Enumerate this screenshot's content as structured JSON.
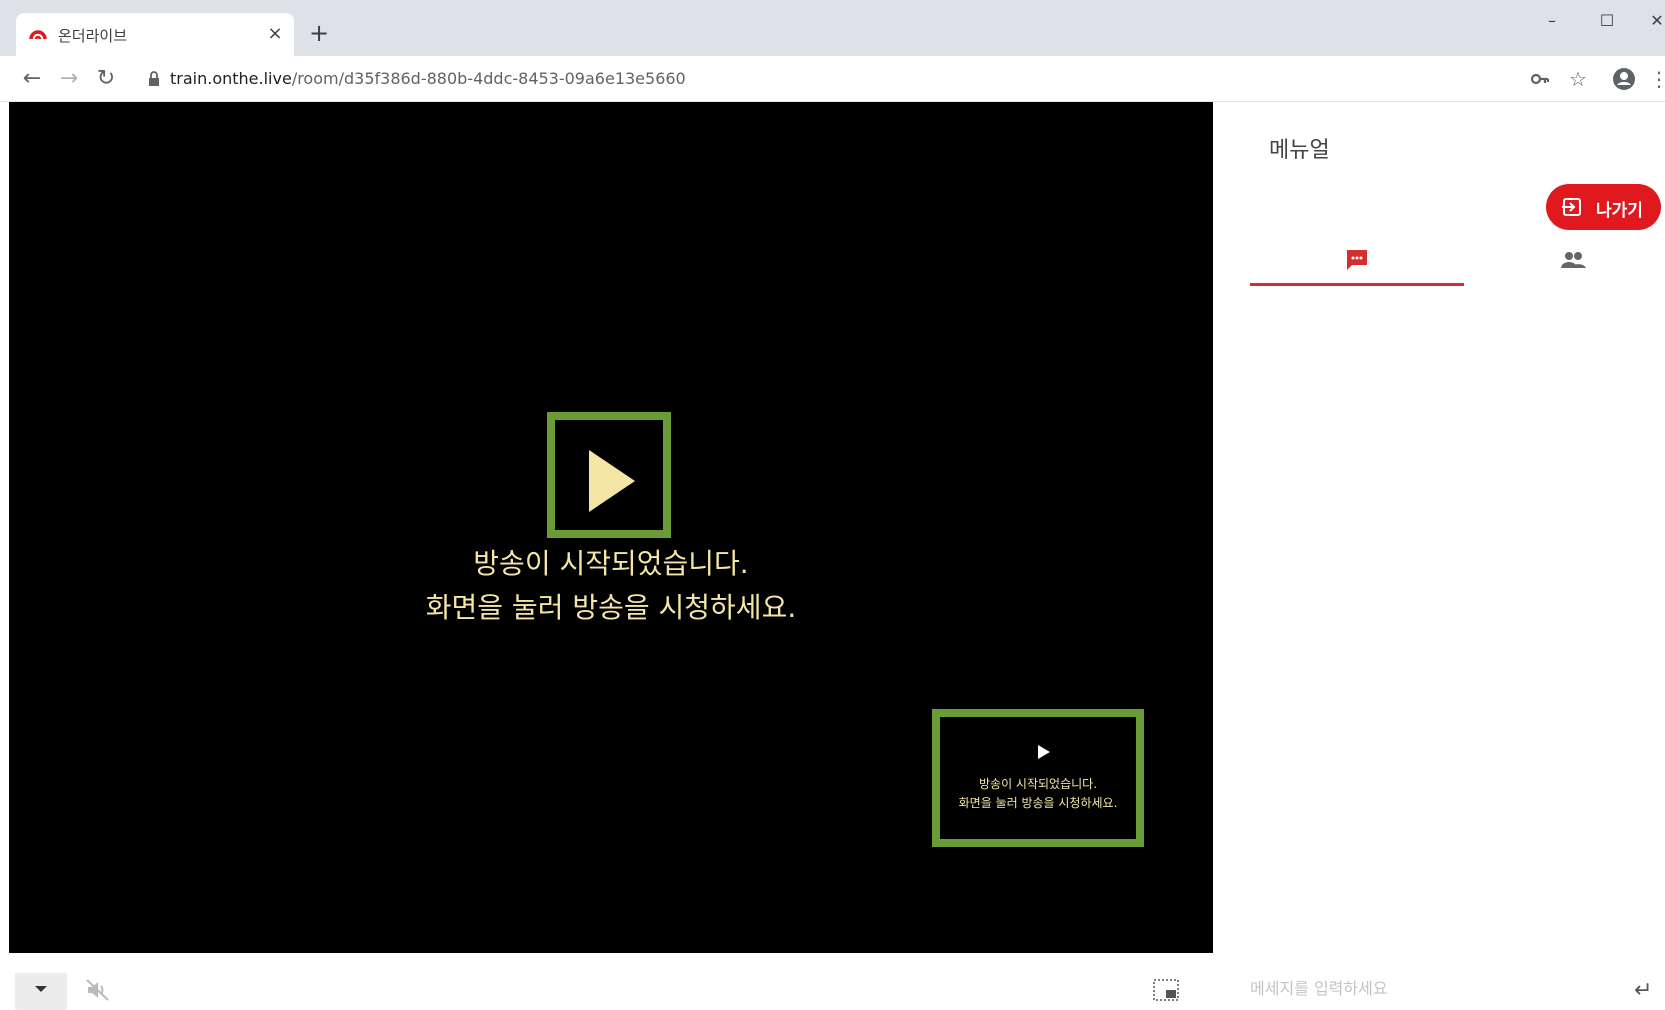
{
  "browser": {
    "tab_title": "온더라이브",
    "tab_close": "×",
    "new_tab": "+",
    "url_host": "train.onthe.live",
    "url_path": "/room/d35f386d-880b-4ddc-8453-09a6e13e5660",
    "window_controls": {
      "minimize": "–",
      "maximize": "☐",
      "close": "✕"
    }
  },
  "video": {
    "message_line1": "방송이 시작되었습니다.",
    "message_line2": "화면을 눌러 방송을 시청하세요.",
    "mini_message_line1": "방송이 시작되었습니다.",
    "mini_message_line2": "화면을 눌러 방송을 시청하세요.",
    "highlight_color": "#6a9c35",
    "text_color": "#f5e6a6"
  },
  "sidebar": {
    "title": "메뉴얼",
    "exit_label": "나가기",
    "accent_color": "#e0191e",
    "tabs": [
      {
        "icon": "chat-icon",
        "active": true
      },
      {
        "icon": "people-icon",
        "active": false
      }
    ]
  },
  "bottom_bar": {
    "chat_placeholder": "메세지를 입력하세요",
    "send_icon": "↵"
  }
}
